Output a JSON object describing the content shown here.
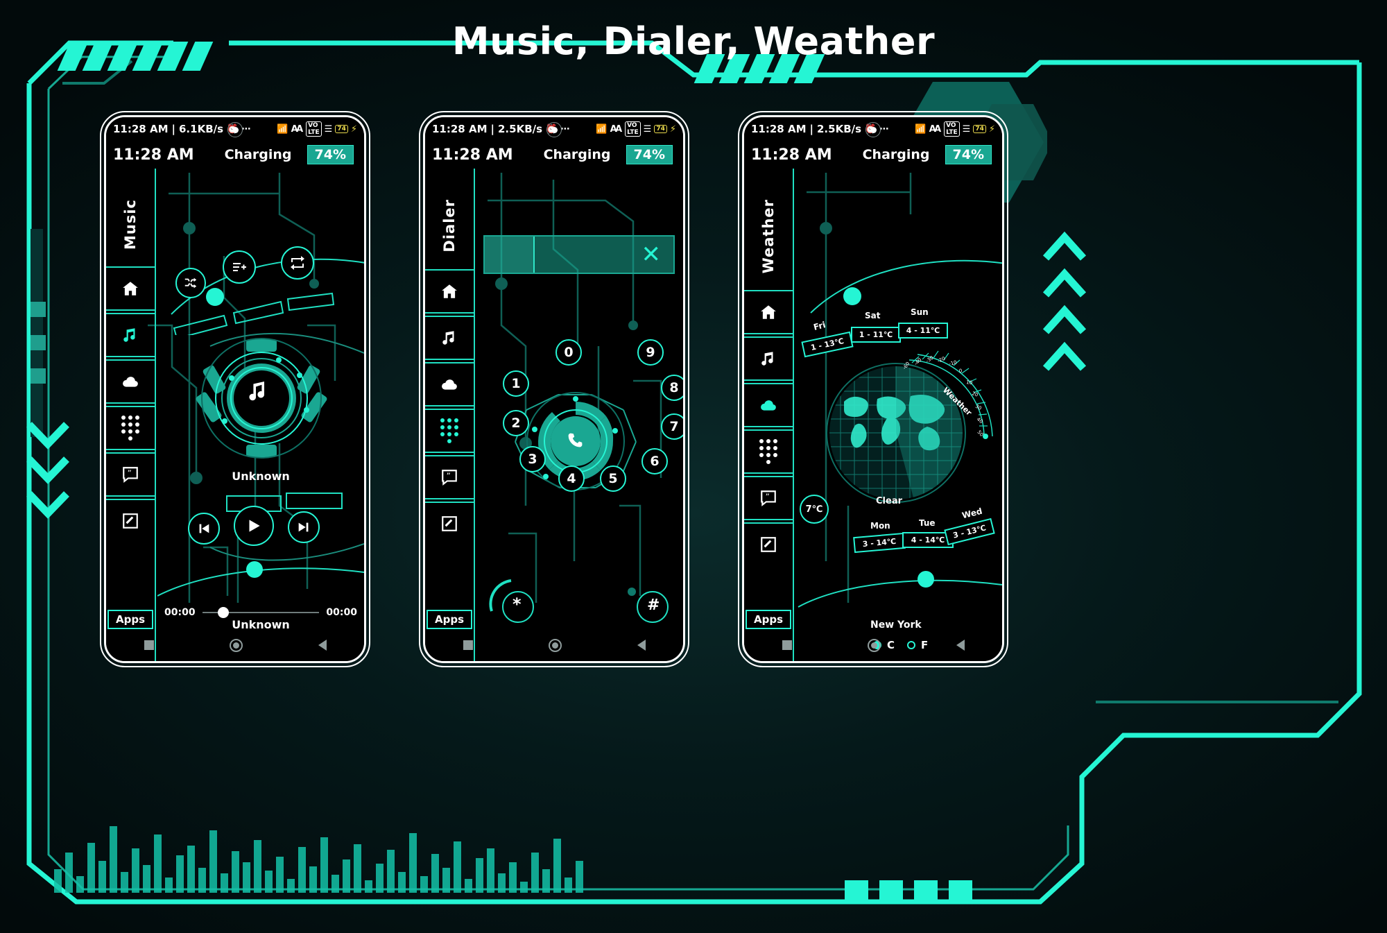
{
  "page": {
    "title": "Music, Dialer, Weather"
  },
  "statusbar": {
    "time": "11:28 AM",
    "separator": "|",
    "net_speeds": [
      "6.1KB/s",
      "2.5KB/s",
      "2.5KB/s"
    ],
    "alarm_icon": "alarm-clock-icon",
    "more_icon": "more-dots-icon",
    "wifi_icon": "wifi-icon",
    "bluetooth_icon": "bluetooth-icon",
    "volte_icon": "volte-icon",
    "signal_icon": "signal-bars-icon",
    "battery_level": "74",
    "charging_bolt": "charging-bolt-icon"
  },
  "chargerow": {
    "clock": "11:28 AM",
    "status": "Charging",
    "percent": "74%"
  },
  "rail": {
    "titles": [
      "Music",
      "Dialer",
      "Weather"
    ],
    "items": [
      {
        "name": "home-icon",
        "label": "Home"
      },
      {
        "name": "music-note-icon",
        "label": "Music"
      },
      {
        "name": "cloud-icon",
        "label": "Weather"
      },
      {
        "name": "dialpad-icon",
        "label": "Dialer"
      },
      {
        "name": "message-quote-icon",
        "label": "Messages"
      },
      {
        "name": "edit-note-icon",
        "label": "Notes"
      }
    ],
    "apps_label": "Apps"
  },
  "music": {
    "title": "Music",
    "top_controls": [
      {
        "name": "shuffle-icon",
        "label": "Shuffle"
      },
      {
        "name": "add-to-playlist-icon",
        "label": "Add to playlist"
      },
      {
        "name": "repeat-icon",
        "label": "Repeat"
      }
    ],
    "disc_icon": "music-note-icon",
    "track_title": "Unknown",
    "track_subtitle": "Unknown",
    "transport": [
      {
        "name": "previous-track-icon",
        "label": "Previous"
      },
      {
        "name": "play-icon",
        "label": "Play"
      },
      {
        "name": "next-track-icon",
        "label": "Next"
      }
    ],
    "time_elapsed": "00:00",
    "time_total": "00:00"
  },
  "dialer": {
    "title": "Dialer",
    "input_value": "",
    "close_icon": "close-x-icon",
    "call_icon": "phone-handset-icon",
    "keys": [
      "0",
      "9",
      "8",
      "7",
      "6",
      "5",
      "4",
      "3",
      "2",
      "1"
    ],
    "star_key": "*",
    "hash_key": "#"
  },
  "weather": {
    "title": "Weather",
    "arc_label": "Weather",
    "current_temp": "7℃",
    "condition": "Clear",
    "city": "New York",
    "units": [
      {
        "label": "C",
        "selected": true
      },
      {
        "label": "F",
        "selected": false
      }
    ],
    "forecast_top": [
      {
        "day": "Fri",
        "range": "1 - 13℃"
      },
      {
        "day": "Sat",
        "range": "1 - 11℃"
      },
      {
        "day": "Sun",
        "range": "4 - 11℃"
      }
    ],
    "forecast_bottom": [
      {
        "day": "Mon",
        "range": "3 - 14℃"
      },
      {
        "day": "Tue",
        "range": "4 - 14℃"
      },
      {
        "day": "Wed",
        "range": "3 - 13℃"
      }
    ],
    "gauge_ticks": [
      "-60",
      "-40",
      "-30",
      "-20",
      "-10",
      "0",
      "10",
      "20",
      "30",
      "40",
      "50"
    ]
  },
  "colors": {
    "accent": "#25f5d4",
    "accent_dim": "#1aa792",
    "panel_bg": "#000000",
    "page_bg": "#05191a",
    "text": "#ffffff",
    "battery_yellow": "#eddc4e"
  }
}
